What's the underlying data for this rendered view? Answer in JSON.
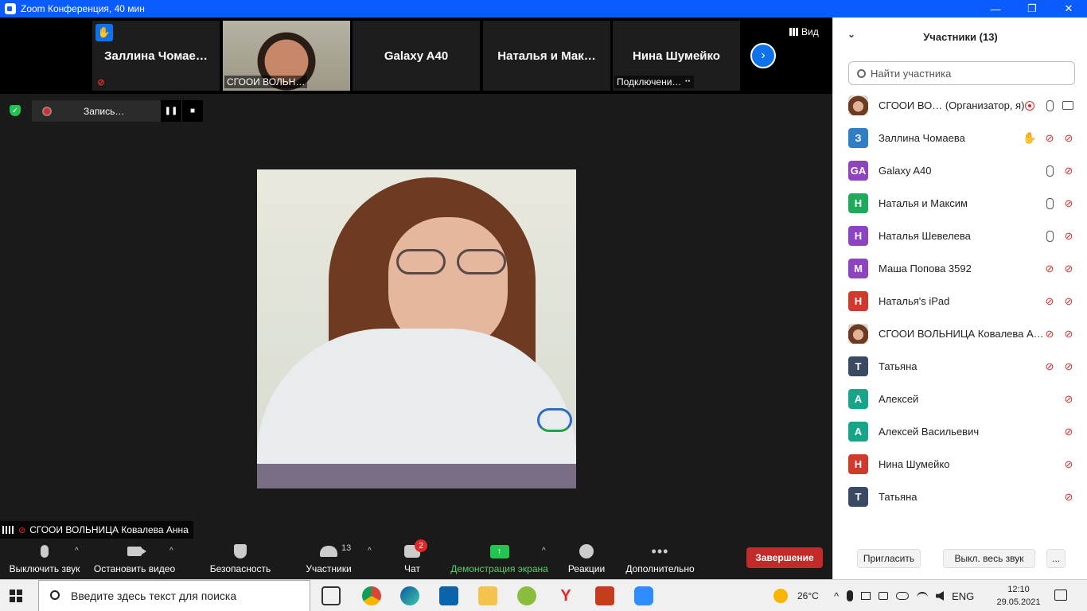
{
  "window": {
    "title": "Zoom Конференция, 40 мин",
    "minimize": "—",
    "maximize": "❐",
    "close": "✕"
  },
  "strip": {
    "thumbs": [
      {
        "name": "Заллина  Чомае…"
      },
      {
        "caption": "СГООИ ВОЛЬН…"
      },
      {
        "name": "Galaxy A40"
      },
      {
        "name": "Наталья  и  Мак…"
      },
      {
        "name": "Нина Шумейко",
        "caption": "Подключени… ⠒"
      }
    ],
    "next_label": "›",
    "view_label": "Вид"
  },
  "recording": {
    "label": "Запись…",
    "pause": "❚❚",
    "stop": "■"
  },
  "main": {
    "speaker": "СГООИ ВОЛЬНИЦА Ковалева Анна"
  },
  "toolbar": {
    "mute": "Выключить звук",
    "stop_video": "Остановить видео",
    "security": "Безопасность",
    "participants": "Участники",
    "participants_count": "13",
    "chat": "Чат",
    "chat_badge": "2",
    "share": "Демонстрация экрана",
    "share_arrow": "↑",
    "reactions": "Реакции",
    "more": "Дополнительно",
    "more_dots": "•••",
    "end": "Завершение",
    "caret": "^"
  },
  "panel": {
    "title": "Участники (13)",
    "collapse": "⌄",
    "search_placeholder": "Найти участника",
    "participants": [
      {
        "initials": "",
        "name": "СГООИ ВО…  (Организатор, я)",
        "color": "",
        "photo": true,
        "rec": true,
        "hand": false,
        "mic": "on",
        "cam": "on"
      },
      {
        "initials": "З",
        "name": "Заллина Чомаева",
        "color": "#2e7fc7",
        "photo": false,
        "rec": false,
        "hand": true,
        "mic": "off",
        "cam": "off"
      },
      {
        "initials": "GA",
        "name": "Galaxy A40",
        "color": "#8e44c2",
        "photo": false,
        "rec": false,
        "hand": false,
        "mic": "on",
        "cam": "off"
      },
      {
        "initials": "Н",
        "name": "Наталья и Максим",
        "color": "#1fa95a",
        "photo": false,
        "rec": false,
        "hand": false,
        "mic": "on",
        "cam": "off"
      },
      {
        "initials": "Н",
        "name": "Наталья Шевелева",
        "color": "#8e44c2",
        "photo": false,
        "rec": false,
        "hand": false,
        "mic": "on",
        "cam": "off"
      },
      {
        "initials": "М",
        "name": "Маша Попова 3592",
        "color": "#8e44c2",
        "photo": false,
        "rec": false,
        "hand": false,
        "mic": "off",
        "cam": "off"
      },
      {
        "initials": "Н",
        "name": "Наталья's iPad",
        "color": "#d0392b",
        "photo": false,
        "rec": false,
        "hand": false,
        "mic": "off",
        "cam": "off"
      },
      {
        "initials": "",
        "name": "СГООИ ВОЛЬНИЦА Ковалева А…",
        "color": "",
        "photo": true,
        "rec": false,
        "hand": false,
        "mic": "off",
        "cam": "off"
      },
      {
        "initials": "Т",
        "name": "Татьяна",
        "color": "#3a4a63",
        "photo": false,
        "rec": false,
        "hand": false,
        "mic": "off",
        "cam": "off"
      },
      {
        "initials": "А",
        "name": "Алексей",
        "color": "#17a589",
        "photo": false,
        "rec": false,
        "hand": false,
        "mic": "none",
        "cam": "off"
      },
      {
        "initials": "А",
        "name": "Алексей Васильевич",
        "color": "#17a589",
        "photo": false,
        "rec": false,
        "hand": false,
        "mic": "none",
        "cam": "off"
      },
      {
        "initials": "Н",
        "name": "Нина Шумейко",
        "color": "#d0392b",
        "photo": false,
        "rec": false,
        "hand": false,
        "mic": "none",
        "cam": "off"
      },
      {
        "initials": "Т",
        "name": "Татьяна",
        "color": "#3a4a63",
        "photo": false,
        "rec": false,
        "hand": false,
        "mic": "none",
        "cam": "off"
      }
    ],
    "invite": "Пригласить",
    "mute_all": "Выкл. весь звук",
    "more": "..."
  },
  "taskbar": {
    "search_placeholder": "Введите здесь текст для поиска",
    "weather": "26°C",
    "lang": "ENG",
    "time": "12:10",
    "date": "29.05.2021"
  }
}
